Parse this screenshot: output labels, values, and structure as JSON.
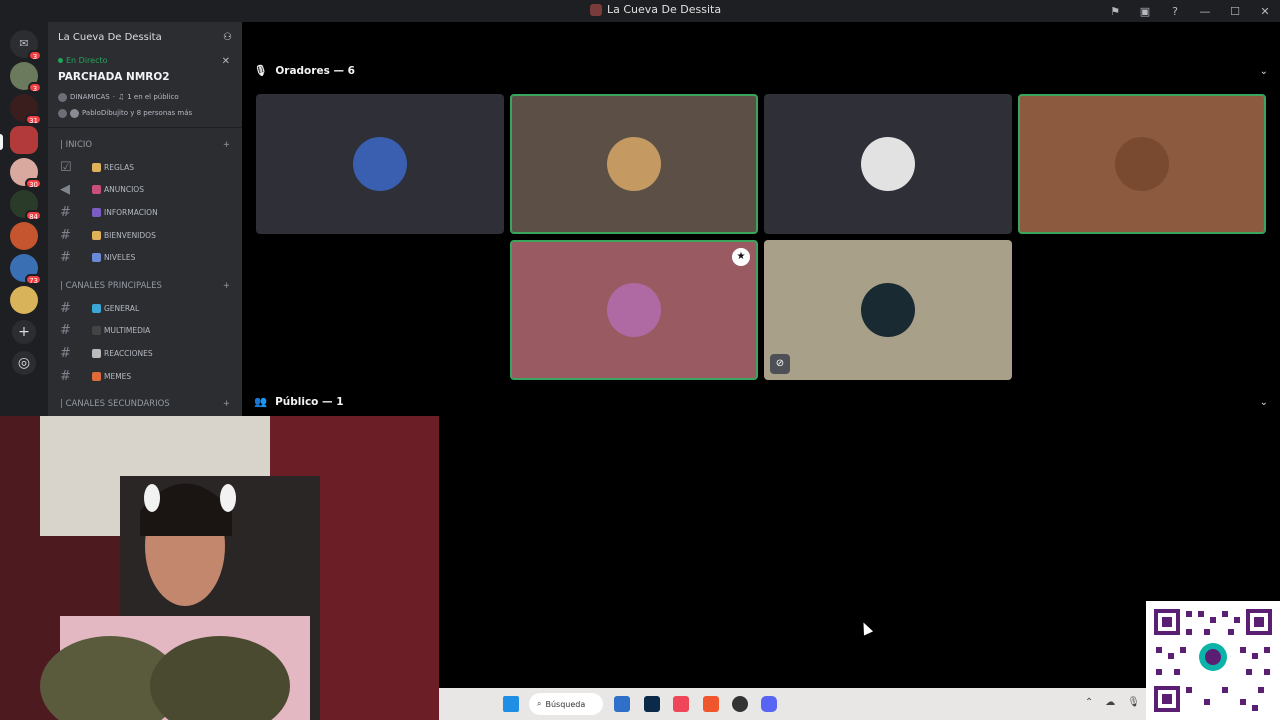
{
  "window": {
    "title": "La Cueva De Dessita"
  },
  "server": {
    "name": "La Cueva De Dessita"
  },
  "stage_card": {
    "status": "En Directo",
    "name": "PARCHADA NMRO2",
    "category": "DINAMICAS",
    "audience": "1 en el público",
    "speakers_summary": "PabloDibujito y 8 personas más"
  },
  "guilds": [
    {
      "badge": "3"
    },
    {
      "badge": "31"
    },
    {
      "badge": ""
    },
    {
      "badge": "30"
    },
    {
      "badge": "84"
    },
    {
      "badge": ""
    },
    {
      "badge": "73"
    },
    {
      "badge": ""
    }
  ],
  "categories": [
    {
      "label": "| INICIO",
      "channels": [
        {
          "label": "REGLAS",
          "icon": "rules-icon"
        },
        {
          "label": "ANUNCIOS",
          "icon": "megaphone-icon"
        },
        {
          "label": "INFORMACION",
          "icon": "hash-icon"
        },
        {
          "label": "BIENVENIDOS",
          "icon": "hash-icon"
        },
        {
          "label": "NIVELES",
          "icon": "hash-icon"
        }
      ]
    },
    {
      "label": "| CANALES PRINCIPALES",
      "channels": [
        {
          "label": "GENERAL",
          "icon": "hash-icon"
        },
        {
          "label": "MULTIMEDIA",
          "icon": "hash-icon"
        },
        {
          "label": "REACCIONES",
          "icon": "hash-icon"
        },
        {
          "label": "MEMES",
          "icon": "hash-icon"
        }
      ]
    },
    {
      "label": "| CANALES SECUNDARIOS",
      "channels": []
    }
  ],
  "stage": {
    "speakers_label": "Oradores — 6",
    "audience_label": "Público — 1",
    "speakers": [
      {
        "bg": "#2e2f37",
        "speaking": false,
        "avatar_color": "#3a5fb0"
      },
      {
        "bg": "#5b4f46",
        "speaking": true,
        "avatar_color": "#c49a62"
      },
      {
        "bg": "#2e2f37",
        "speaking": false,
        "avatar_color": "#e2e2e2"
      },
      {
        "bg": "#8c5a3f",
        "speaking": true,
        "avatar_color": "#7a4a30"
      },
      {
        "bg": "#995a62",
        "speaking": true,
        "avatar_color": "#b06aa3",
        "moderator": true
      },
      {
        "bg": "#a8a089",
        "speaking": false,
        "avatar_color": "#1a2a33",
        "muted": true
      }
    ]
  },
  "taskbar": {
    "search_placeholder": "Búsqueda"
  },
  "colors": {
    "accent": "#23a559",
    "sidebar": "#2b2d31",
    "rail": "#1e1f22"
  }
}
